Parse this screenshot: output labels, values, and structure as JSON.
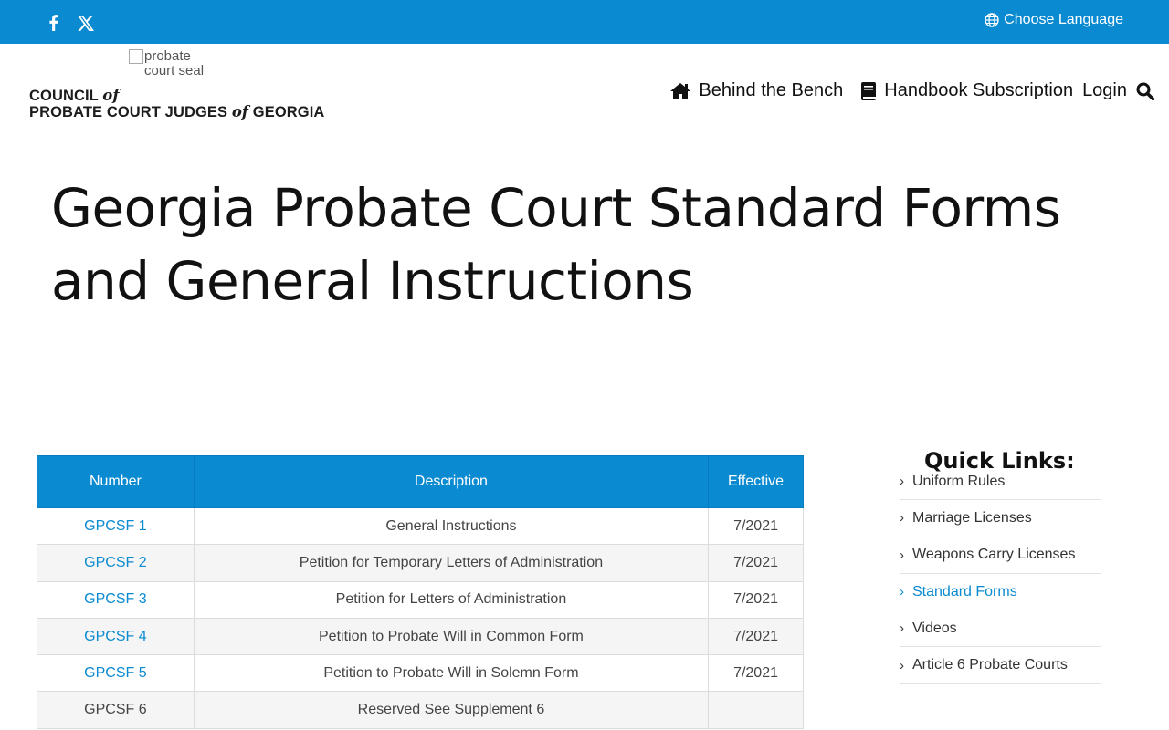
{
  "topbar": {
    "social": [
      "facebook-icon",
      "x-icon"
    ],
    "language_label": "Choose Language"
  },
  "header": {
    "seal_alt": "probate court seal",
    "org_line1_a": "COUNCIL ",
    "org_line1_of": "of",
    "org_line2_a": "PROBATE COURT JUDGES ",
    "org_line2_of": "of",
    "org_line2_b": " GEORGIA"
  },
  "nav": {
    "items": [
      {
        "label": "Behind the Bench",
        "icon": "home-icon"
      },
      {
        "label": "Handbook Subscription",
        "icon": "book-icon"
      },
      {
        "label": "Login"
      }
    ],
    "search_icon": "search-icon"
  },
  "page": {
    "title": "Georgia Probate Court Standard Forms and General Instructions"
  },
  "table": {
    "headers": [
      "Number",
      "Description",
      "Effective"
    ],
    "rows": [
      {
        "number": "GPCSF 1",
        "description": "General Instructions",
        "effective": "7/2021",
        "link": true
      },
      {
        "number": "GPCSF 2",
        "description": "Petition for Temporary Letters of Administration",
        "effective": "7/2021",
        "link": true
      },
      {
        "number": "GPCSF 3",
        "description": "Petition for Letters of Administration",
        "effective": "7/2021",
        "link": true
      },
      {
        "number": "GPCSF 4",
        "description": "Petition to Probate Will in Common Form",
        "effective": "7/2021",
        "link": true
      },
      {
        "number": "GPCSF 5",
        "description": "Petition to Probate Will in Solemn Form",
        "effective": "7/2021",
        "link": true
      },
      {
        "number": "GPCSF 6",
        "description": "Reserved See Supplement 6",
        "effective": "",
        "link": false
      }
    ]
  },
  "sidebar": {
    "title": "Quick Links:",
    "links": [
      {
        "label": "Uniform Rules",
        "active": false
      },
      {
        "label": "Marriage Licenses",
        "active": false
      },
      {
        "label": "Weapons Carry Licenses",
        "active": false
      },
      {
        "label": "Standard Forms",
        "active": true
      },
      {
        "label": "Videos",
        "active": false
      },
      {
        "label": "Article 6 Probate Courts",
        "active": false
      }
    ]
  },
  "colors": {
    "brand_blue": "#0a8ad0",
    "link_blue": "#0a8ad0",
    "row_stripe": "#f5f5f5"
  }
}
